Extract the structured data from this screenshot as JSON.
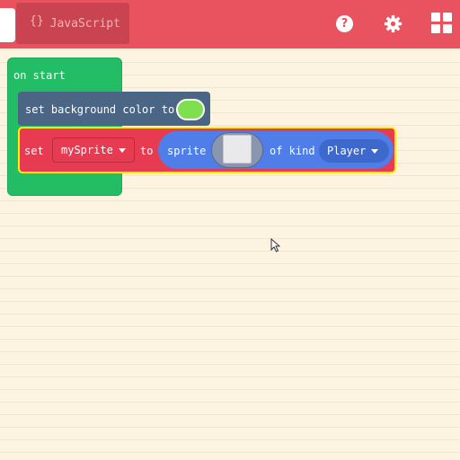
{
  "header": {
    "tabs": [
      {
        "label": ""
      },
      {
        "label": "JavaScript",
        "icon": "curly-braces-icon",
        "braces": "{}"
      }
    ],
    "help_glyph": "?",
    "icons": [
      "help-icon",
      "gear-icon",
      "app-grid-icon"
    ],
    "color": "#e9525f"
  },
  "workspace": {
    "background": "#fcf3e0",
    "blocks": {
      "on_start": {
        "label": "on start",
        "color": "#22bd65"
      },
      "set_background": {
        "label": "set background color to",
        "swatch_color": "#7ee04e",
        "color": "#4b6584"
      },
      "set_sprite": {
        "set_label": "set",
        "variable": "mySprite",
        "to_label": "to",
        "sprite_label": "sprite",
        "of_kind_label": "of kind",
        "kind": "Player",
        "color": "#e63b51",
        "highlight_color": "#fff200",
        "sprite_block_color": "#4f7ee8"
      }
    }
  }
}
